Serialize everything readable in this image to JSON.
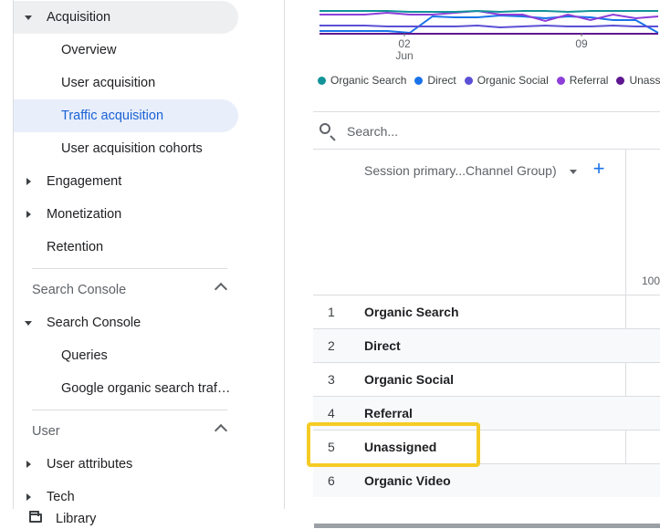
{
  "sidebar": {
    "acquisition": {
      "label": "Acquisition",
      "items": [
        "Overview",
        "User acquisition",
        "Traffic acquisition",
        "User acquisition cohorts"
      ],
      "selected": "Traffic acquisition"
    },
    "engagement": "Engagement",
    "monetization": "Monetization",
    "retention": "Retention",
    "search_console_section": "Search Console",
    "search_console": {
      "label": "Search Console",
      "items": [
        "Queries",
        "Google organic search traf…"
      ]
    },
    "user_section": "User",
    "user_attributes": "User attributes",
    "tech": "Tech",
    "library": "Library"
  },
  "chart_data": {
    "type": "line",
    "x_ticks": [
      {
        "label": "02",
        "sublabel": "Jun"
      },
      {
        "label": "09"
      }
    ],
    "series": [
      {
        "name": "Organic Search",
        "color": "#12939a"
      },
      {
        "name": "Direct",
        "color": "#1a73e8"
      },
      {
        "name": "Organic Social",
        "color": "#5b4fd6"
      },
      {
        "name": "Referral",
        "color": "#8e3fd9"
      },
      {
        "name": "Unassigned",
        "color": "#5e1791"
      }
    ],
    "legend_visible": [
      "Organic Search",
      "Direct",
      "Organic Social",
      "Referral",
      "Unass"
    ],
    "legend_placement": "bottom"
  },
  "table": {
    "search_placeholder": "Search...",
    "dimension_header": "Session primary...Channel Group)",
    "add_button": "+",
    "metric_axis_tick": "100",
    "rows": [
      {
        "rank": "1",
        "channel": "Organic Search"
      },
      {
        "rank": "2",
        "channel": "Direct"
      },
      {
        "rank": "3",
        "channel": "Organic Social"
      },
      {
        "rank": "4",
        "channel": "Referral"
      },
      {
        "rank": "5",
        "channel": "Unassigned"
      },
      {
        "rank": "6",
        "channel": "Organic Video"
      }
    ],
    "highlighted_row": "Unassigned"
  }
}
